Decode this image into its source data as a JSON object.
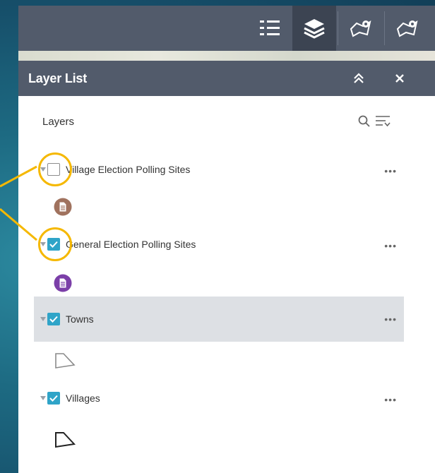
{
  "panel": {
    "title": "Layer List",
    "subheading": "Layers"
  },
  "layers": [
    {
      "label": "Village Election Polling Sites",
      "checked": false,
      "symbol": "document-icon",
      "symbol_color": "#a0725e"
    },
    {
      "label": "General Election Polling Sites",
      "checked": true,
      "symbol": "document-icon",
      "symbol_color": "#7b3fa8"
    },
    {
      "label": "Towns",
      "checked": true,
      "symbol": "polygon-icon",
      "symbol_color": "#8a8a8a"
    },
    {
      "label": "Villages",
      "checked": true,
      "symbol": "polygon-icon",
      "symbol_color": "#222222"
    }
  ],
  "more_label": "•••",
  "colors": {
    "header": "#525b6b",
    "checkbox": "#2fa4c8",
    "highlight": "#f5b800",
    "selected_row": "#dde0e4"
  },
  "icons": [
    "layers-list-icon",
    "layers-stack-icon",
    "map-pin-icon",
    "collapse-icon",
    "close-icon",
    "search-icon",
    "filter-icon",
    "more-icon"
  ]
}
